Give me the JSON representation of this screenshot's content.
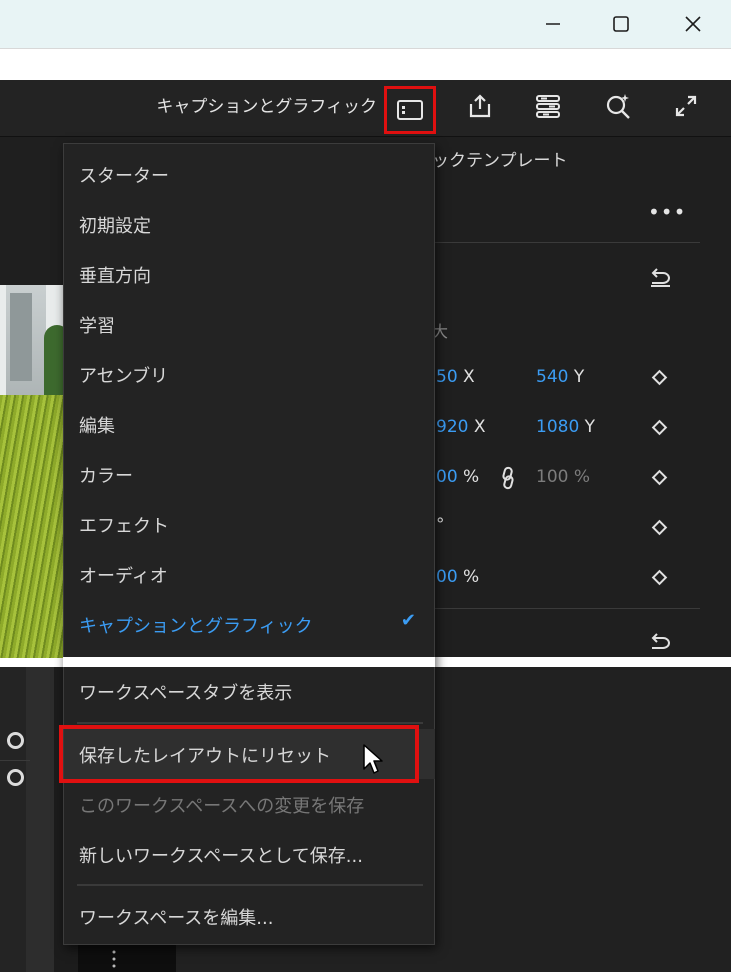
{
  "window": {
    "minimize_label": "—",
    "maximize_label": "□",
    "close_label": "✕"
  },
  "toolbar": {
    "workspace_name": "キャプションとグラフィック",
    "icons": [
      "workspace-layout-icon",
      "share-export-icon",
      "panel-settings-icon",
      "search-zoom-icon",
      "fullscreen-icon"
    ]
  },
  "panel": {
    "title": "ックテンプレート",
    "more_label": "•••",
    "faint_label": "大",
    "rows": [
      {
        "a": "50",
        "a_unit": "X",
        "b": "540",
        "b_unit": "Y"
      },
      {
        "a": "920",
        "a_unit": "X",
        "b": "1080",
        "b_unit": "Y"
      },
      {
        "a": "00",
        "a_unit": "%",
        "b": "100 %"
      },
      {
        "a_unit": "°"
      },
      {
        "a": "00",
        "a_unit": "%"
      }
    ]
  },
  "menu": {
    "items": [
      {
        "label": "スターター"
      },
      {
        "label": "初期設定"
      },
      {
        "label": "垂直方向"
      },
      {
        "label": "学習"
      },
      {
        "label": "アセンブリ"
      },
      {
        "label": "編集"
      },
      {
        "label": "カラー"
      },
      {
        "label": "エフェクト"
      },
      {
        "label": "オーディオ"
      },
      {
        "label": "キャプションとグラフィック",
        "active": true,
        "checked": true
      }
    ],
    "show_tabs": "ワークスペースタブを表示",
    "reset_layout": "保存したレイアウトにリセット",
    "save_changes": "このワークスペースへの変更を保存",
    "save_new": "新しいワークスペースとして保存...",
    "edit_workspaces": "ワークスペースを編集...",
    "check_mark": "✔"
  },
  "colors": {
    "accent_blue": "#3b9cf3",
    "highlight_red": "#e01010",
    "menu_bg": "#232323"
  }
}
